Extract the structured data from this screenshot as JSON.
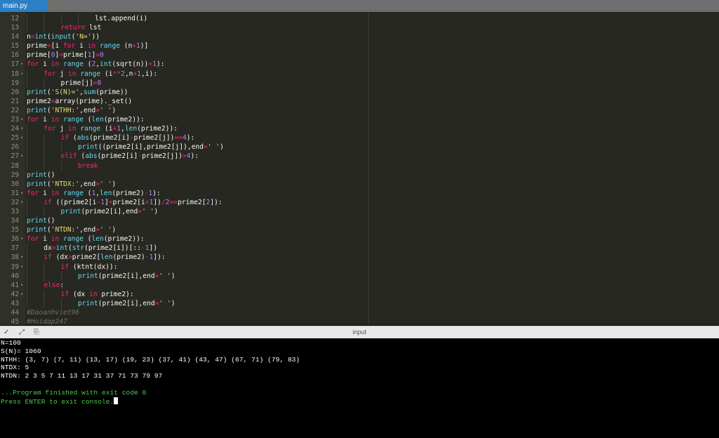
{
  "tab": {
    "filename": "main.py"
  },
  "editor": {
    "lines": [
      {
        "n": "12",
        "fold": "",
        "indent": 4,
        "html": "lst.append(i)"
      },
      {
        "n": "13",
        "fold": "",
        "indent": 2,
        "html": "<span class='kw'>return</span> lst"
      },
      {
        "n": "14",
        "fold": "",
        "indent": 0,
        "html": "n<span class='kw'>=</span><span class='fn'>int</span>(<span class='fn'>input</span>(<span class='st'>'N='</span>))"
      },
      {
        "n": "15",
        "fold": "",
        "indent": 0,
        "html": "prime<span class='kw'>=</span>[i <span class='kw'>for</span> i <span class='kw'>in</span> <span class='fn'>range</span> (n<span class='kw'>+</span><span class='nm'>1</span>)]"
      },
      {
        "n": "16",
        "fold": "",
        "indent": 0,
        "html": "prime[<span class='nm'>0</span>]<span class='kw'>=</span>prime[<span class='nm'>1</span>]<span class='kw'>=</span><span class='nm'>0</span>"
      },
      {
        "n": "17",
        "fold": "▾",
        "indent": 0,
        "html": "<span class='kw'>for</span> i <span class='kw'>in</span> <span class='fn'>range</span> (<span class='nm'>2</span>,<span class='fn'>int</span>(sqrt(n))<span class='kw'>+</span><span class='nm'>1</span>):"
      },
      {
        "n": "18",
        "fold": "▾",
        "indent": 1,
        "html": "<span class='kw'>for</span> j <span class='kw'>in</span> <span class='fn'>range</span> (i<span class='kw'>**</span><span class='nm'>2</span>,n<span class='kw'>+</span><span class='nm'>1</span>,i):"
      },
      {
        "n": "19",
        "fold": "",
        "indent": 2,
        "html": "prime[j]<span class='kw'>=</span><span class='nm'>0</span>"
      },
      {
        "n": "20",
        "fold": "",
        "indent": 0,
        "html": "<span class='fn'>print</span>(<span class='st'>'S(N)='</span>,<span class='fn'>sum</span>(prime))"
      },
      {
        "n": "21",
        "fold": "",
        "indent": 0,
        "html": "prime2<span class='kw'>=</span>array(prime)._set()"
      },
      {
        "n": "22",
        "fold": "",
        "indent": 0,
        "html": "<span class='fn'>print</span>(<span class='st'>'NTHH:'</span>,end<span class='kw'>=</span><span class='st'>' '</span>)"
      },
      {
        "n": "23",
        "fold": "▾",
        "indent": 0,
        "html": "<span class='kw'>for</span> i <span class='kw'>in</span> <span class='fn'>range</span> (<span class='fn'>len</span>(prime2)):"
      },
      {
        "n": "24",
        "fold": "▾",
        "indent": 1,
        "html": "<span class='kw'>for</span> j <span class='kw'>in</span> <span class='fn'>range</span> (i<span class='kw'>+</span><span class='nm'>1</span>,<span class='fn'>len</span>(prime2)):"
      },
      {
        "n": "25",
        "fold": "▾",
        "indent": 2,
        "html": "<span class='kw'>if</span> (<span class='fn'>abs</span>(prime2[i]<span class='kw'>-</span>prime2[j])<span class='kw'>==</span><span class='nm'>4</span>):"
      },
      {
        "n": "26",
        "fold": "",
        "indent": 3,
        "html": "<span class='fn'>print</span>((prime2[i],prime2[j]),end<span class='kw'>=</span><span class='st'>' '</span>)"
      },
      {
        "n": "27",
        "fold": "▾",
        "indent": 2,
        "html": "<span class='kw'>elif</span> (<span class='fn'>abs</span>(prime2[i]<span class='kw'>-</span>prime2[j])<span class='kw'>&gt;</span><span class='nm'>4</span>):"
      },
      {
        "n": "28",
        "fold": "",
        "indent": 3,
        "html": "<span class='kw'>break</span>"
      },
      {
        "n": "29",
        "fold": "",
        "indent": 0,
        "html": "<span class='fn'>print</span>()"
      },
      {
        "n": "30",
        "fold": "",
        "indent": 0,
        "html": "<span class='fn'>print</span>(<span class='st'>'NTDX:'</span>,end<span class='kw'>=</span><span class='st'>' '</span>)"
      },
      {
        "n": "31",
        "fold": "▾",
        "indent": 0,
        "html": "<span class='kw'>for</span> i <span class='kw'>in</span> <span class='fn'>range</span> (<span class='nm'>1</span>,<span class='fn'>len</span>(prime2)<span class='kw'>-</span><span class='nm'>1</span>):"
      },
      {
        "n": "32",
        "fold": "▾",
        "indent": 1,
        "html": "<span class='kw'>if</span> ((prime2[i<span class='kw'>-</span><span class='nm'>1</span>]<span class='kw'>+</span>prime2[i<span class='kw'>+</span><span class='nm'>1</span>])<span class='kw'>/</span><span class='nm'>2</span><span class='kw'>==</span>prime2[<span class='nm'>2</span>]):"
      },
      {
        "n": "33",
        "fold": "",
        "indent": 2,
        "html": "<span class='fn'>print</span>(prime2[i],end<span class='kw'>=</span><span class='st'>' '</span>)"
      },
      {
        "n": "34",
        "fold": "",
        "indent": 0,
        "html": "<span class='fn'>print</span>()"
      },
      {
        "n": "35",
        "fold": "",
        "indent": 0,
        "html": "<span class='fn'>print</span>(<span class='st'>'NTDN:'</span>,end<span class='kw'>=</span><span class='st'>' '</span>)"
      },
      {
        "n": "36",
        "fold": "▾",
        "indent": 0,
        "html": "<span class='kw'>for</span> i <span class='kw'>in</span> <span class='fn'>range</span> (<span class='fn'>len</span>(prime2)):"
      },
      {
        "n": "37",
        "fold": "",
        "indent": 1,
        "html": "dx<span class='kw'>=</span><span class='fn'>int</span>(<span class='fn'>str</span>(prime2[i])[::<span class='kw'>-</span><span class='nm'>1</span>])"
      },
      {
        "n": "38",
        "fold": "▾",
        "indent": 1,
        "html": "<span class='kw'>if</span> (dx<span class='kw'>&gt;</span>prime2[<span class='fn'>len</span>(prime2)<span class='kw'>-</span><span class='nm'>1</span>]):"
      },
      {
        "n": "39",
        "fold": "▾",
        "indent": 2,
        "html": "<span class='kw'>if</span> (ktnt(dx)):"
      },
      {
        "n": "40",
        "fold": "",
        "indent": 3,
        "html": "<span class='fn'>print</span>(prime2[i],end<span class='kw'>=</span><span class='st'>' '</span>)"
      },
      {
        "n": "41",
        "fold": "▾",
        "indent": 1,
        "html": "<span class='kw'>else</span>:"
      },
      {
        "n": "42",
        "fold": "▾",
        "indent": 2,
        "html": "<span class='kw'>if</span> (dx <span class='kw'>in</span> prime2):"
      },
      {
        "n": "43",
        "fold": "",
        "indent": 3,
        "html": "<span class='fn'>print</span>(prime2[i],end<span class='kw'>=</span><span class='st'>' '</span>)"
      },
      {
        "n": "44",
        "fold": "",
        "indent": 0,
        "html": "<span class='cm'>#Daoanhviet96</span>"
      },
      {
        "n": "45",
        "fold": "",
        "indent": 0,
        "html": "<span class='cm'>#Hoidap247</span>"
      }
    ]
  },
  "console": {
    "title": "input",
    "output": [
      {
        "text": "N=100",
        "cls": ""
      },
      {
        "text": "S(N)= 1060",
        "cls": ""
      },
      {
        "text": "NTHH: (3, 7) (7, 11) (13, 17) (19, 23) (37, 41) (43, 47) (67, 71) (79, 83)",
        "cls": ""
      },
      {
        "text": "NTDX: 5",
        "cls": ""
      },
      {
        "text": "NTDN: 2 3 5 7 11 13 17 31 37 71 73 79 97",
        "cls": ""
      },
      {
        "text": "",
        "cls": ""
      },
      {
        "text": "...Program finished with exit code 0",
        "cls": "green"
      },
      {
        "text": "Press ENTER to exit console.",
        "cls": "green",
        "cursor": true
      }
    ]
  }
}
